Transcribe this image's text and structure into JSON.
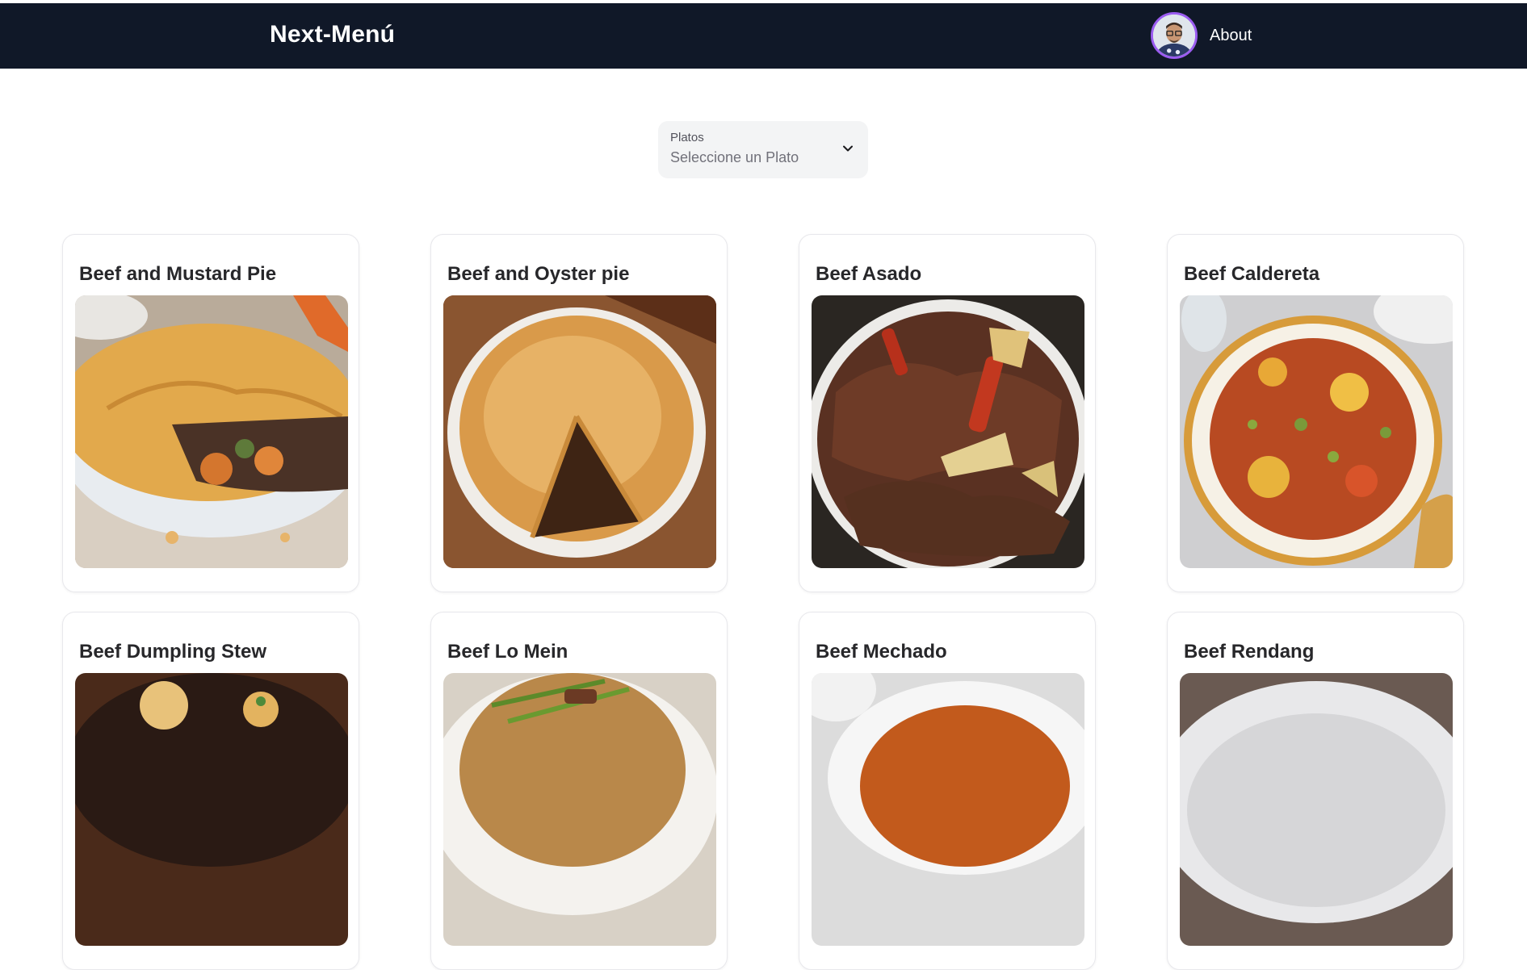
{
  "navbar": {
    "brand": "Next-Menú",
    "about_label": "About",
    "background": "#101828",
    "avatar_ring": "#9b5cf0"
  },
  "filter": {
    "label": "Platos",
    "placeholder": "Seleccione un Plato"
  },
  "dishes": [
    {
      "name": "Beef and Mustard Pie"
    },
    {
      "name": "Beef and Oyster pie"
    },
    {
      "name": "Beef Asado"
    },
    {
      "name": "Beef Caldereta"
    },
    {
      "name": "Beef Dumpling Stew"
    },
    {
      "name": "Beef Lo Mein"
    },
    {
      "name": "Beef Mechado"
    },
    {
      "name": "Beef Rendang"
    }
  ]
}
